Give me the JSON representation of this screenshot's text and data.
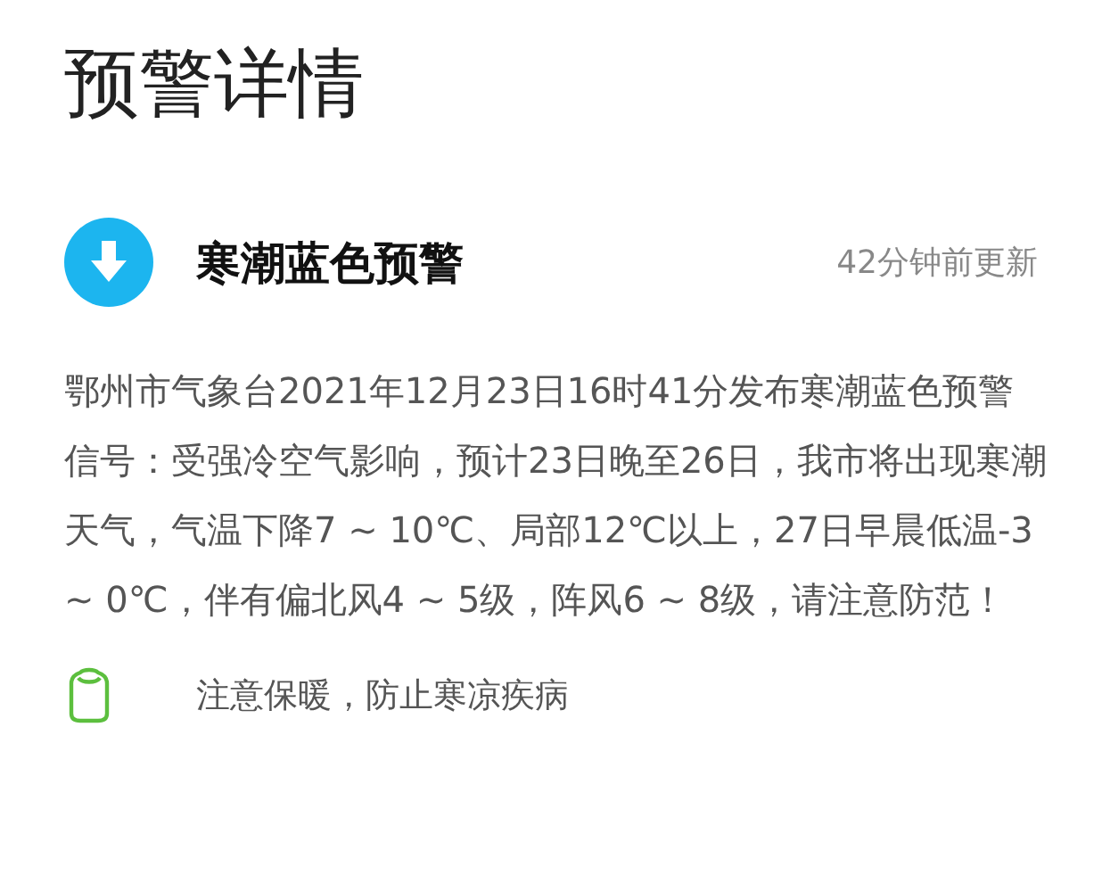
{
  "page": {
    "title": "预警详情"
  },
  "alert": {
    "title": "寒潮蓝色预警",
    "updated": "42分钟前更新",
    "color": "#1cb5ef",
    "description": "鄂州市气象台2021年12月23日16时41分发布寒潮蓝色预警信号：受强冷空气影响，预计23日晚至26日，我市将出现寒潮天气，气温下降7 ~ 10℃、局部12℃以上，27日早晨低温-3 ~ 0℃，伴有偏北风4 ~ 5级，阵风6 ~ 8级，请注意防范！"
  },
  "tips": [
    {
      "text": "注意保暖，防止寒凉疾病"
    }
  ]
}
